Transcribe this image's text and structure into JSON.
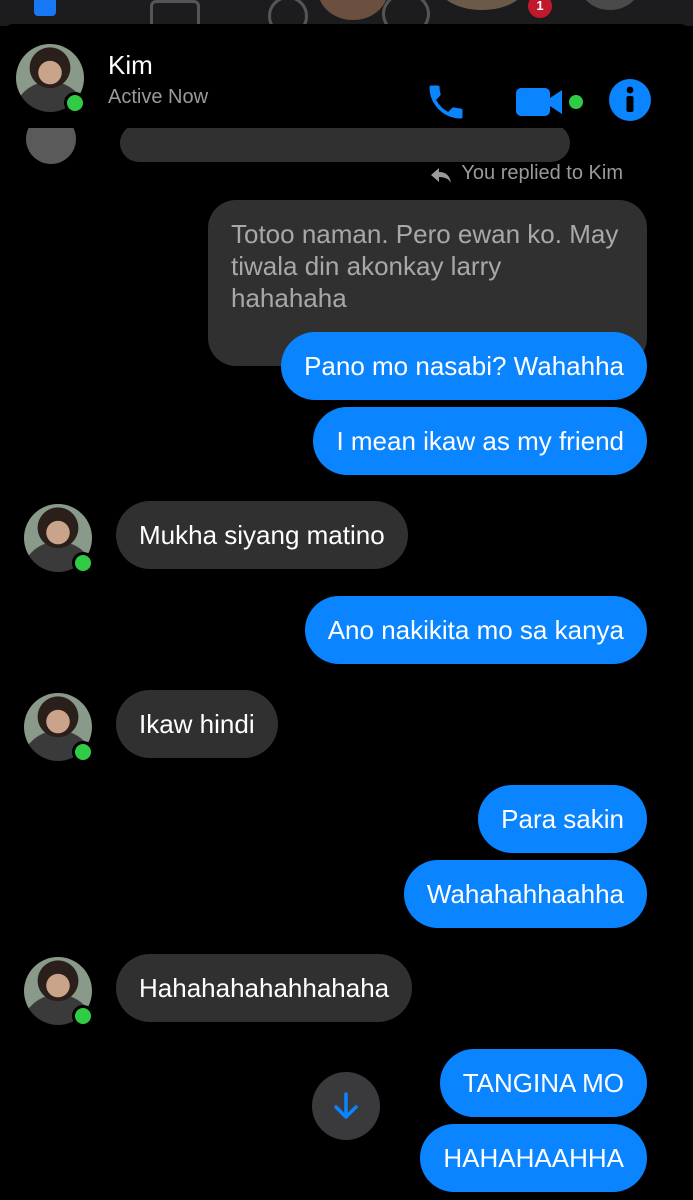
{
  "header": {
    "name": "Kim",
    "status": "Active Now"
  },
  "reply_note": "You replied to Kim",
  "quoted_message": "Totoo naman. Pero ewan ko. May tiwala din akonkay larry hahahaha",
  "messages": [
    {
      "side": "out",
      "text": "Pano mo nasabi? Wahahha"
    },
    {
      "side": "out",
      "text": "I mean ikaw as my friend"
    },
    {
      "side": "in",
      "text": "Mukha siyang matino"
    },
    {
      "side": "out",
      "text": "Ano nakikita mo sa kanya"
    },
    {
      "side": "in",
      "text": "Ikaw hindi"
    },
    {
      "side": "out",
      "text": "Para sakin"
    },
    {
      "side": "out",
      "text": "Wahahahhaahha"
    },
    {
      "side": "in",
      "text": "Hahahahahahhahaha"
    },
    {
      "side": "out",
      "text": "TANGINA MO"
    },
    {
      "side": "out",
      "text": "HAHAHAAHHA"
    }
  ],
  "topbar_badge": "1",
  "colors": {
    "accent": "#0a84ff",
    "incoming_bubble": "#303030",
    "online": "#31cc46",
    "background": "#000000"
  },
  "icons": [
    "phone-icon",
    "video-call-icon",
    "info-icon",
    "reply-arrow-icon",
    "scroll-down-arrow-icon"
  ]
}
